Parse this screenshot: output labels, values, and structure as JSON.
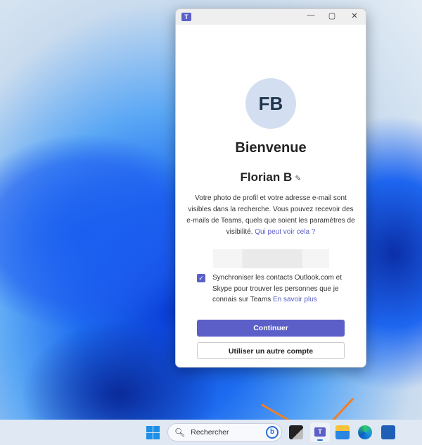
{
  "window": {
    "minimize": "—",
    "maximize": "▢",
    "close": "✕",
    "app_icon": "teams-icon"
  },
  "profile": {
    "initials": "FB",
    "welcome": "Bienvenue",
    "name": "Florian B"
  },
  "description": {
    "text": "Votre photo de profil et votre adresse e-mail sont visibles dans la recherche. Vous pouvez recevoir des e-mails de Teams, quels que soient les paramètres de visibilité.",
    "link": "Qui peut voir cela ?"
  },
  "sync": {
    "checked": true,
    "text": "Synchroniser les contacts Outlook.com et Skype pour trouver les personnes que je connais sur Teams",
    "link": "En savoir plus"
  },
  "buttons": {
    "continue": "Continuer",
    "other_account": "Utiliser un autre compte"
  },
  "taskbar": {
    "search_placeholder": "Rechercher"
  },
  "colors": {
    "accent": "#5b5fc7",
    "arrow": "#f07e2a"
  }
}
